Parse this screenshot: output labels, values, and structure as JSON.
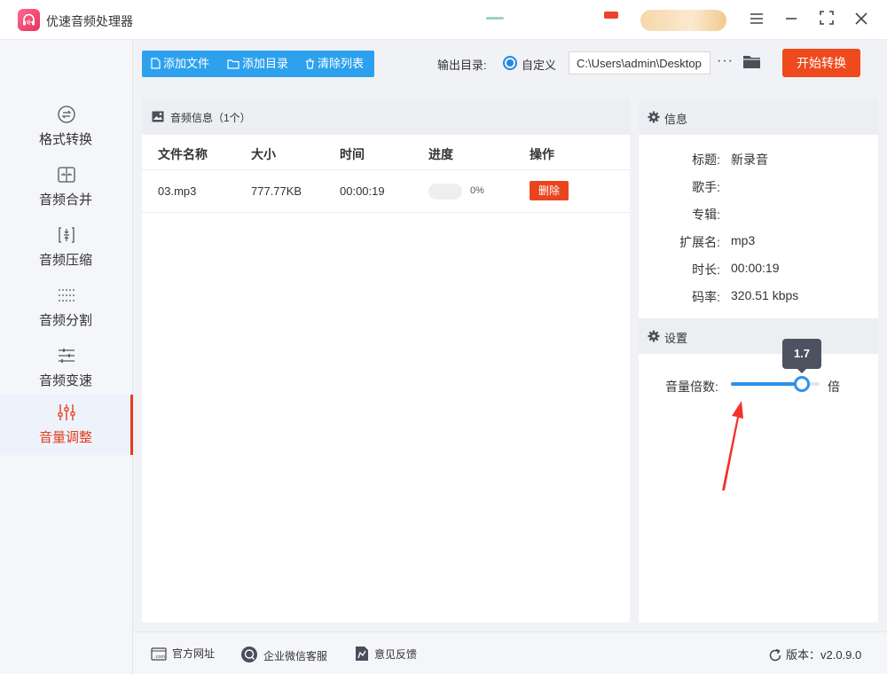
{
  "window": {
    "title": "优速音频处理器"
  },
  "sidebar": {
    "items": [
      {
        "label": "格式转换",
        "icon": "format-convert-icon"
      },
      {
        "label": "音频合并",
        "icon": "merge-icon"
      },
      {
        "label": "音频压缩",
        "icon": "compress-icon"
      },
      {
        "label": "音频分割",
        "icon": "split-icon"
      },
      {
        "label": "音频变速",
        "icon": "speed-icon"
      },
      {
        "label": "音量调整",
        "icon": "volume-adjust-icon",
        "active": true
      }
    ]
  },
  "toolbar": {
    "add_file": "添加文件",
    "add_folder": "添加目录",
    "clear_list": "清除列表",
    "output_label": "输出目录:",
    "output_option": "自定义",
    "output_path": "C:\\Users\\admin\\Desktop",
    "start": "开始转换"
  },
  "file_panel": {
    "title": "音频信息（1个）",
    "columns": [
      "文件名称",
      "大小",
      "时间",
      "进度",
      "操作"
    ],
    "rows": [
      {
        "name": "03.mp3",
        "size": "777.77KB",
        "time": "00:00:19",
        "progress": 0,
        "progress_label": "0%",
        "action": "删除"
      }
    ]
  },
  "info_panel": {
    "title": "信息",
    "fields": [
      {
        "label": "标题:",
        "value": "新录音"
      },
      {
        "label": "歌手:",
        "value": ""
      },
      {
        "label": "专辑:",
        "value": ""
      },
      {
        "label": "扩展名:",
        "value": "mp3"
      },
      {
        "label": "时长:",
        "value": "00:00:19"
      },
      {
        "label": "码率:",
        "value": "320.51 kbps"
      }
    ]
  },
  "settings_panel": {
    "title": "设置",
    "volume_label": "音量倍数:",
    "volume_value": "1.7",
    "volume_fraction": 0.8,
    "volume_unit": "倍"
  },
  "footer": {
    "website": "官方网址",
    "wechat_support": "企业微信客服",
    "feedback": "意见反馈",
    "version": "版本：v2.0.9.0"
  },
  "colors": {
    "accent_blue": "#2ea1ee",
    "accent_red": "#ee4a1e",
    "slider_blue": "#2e91e8"
  }
}
